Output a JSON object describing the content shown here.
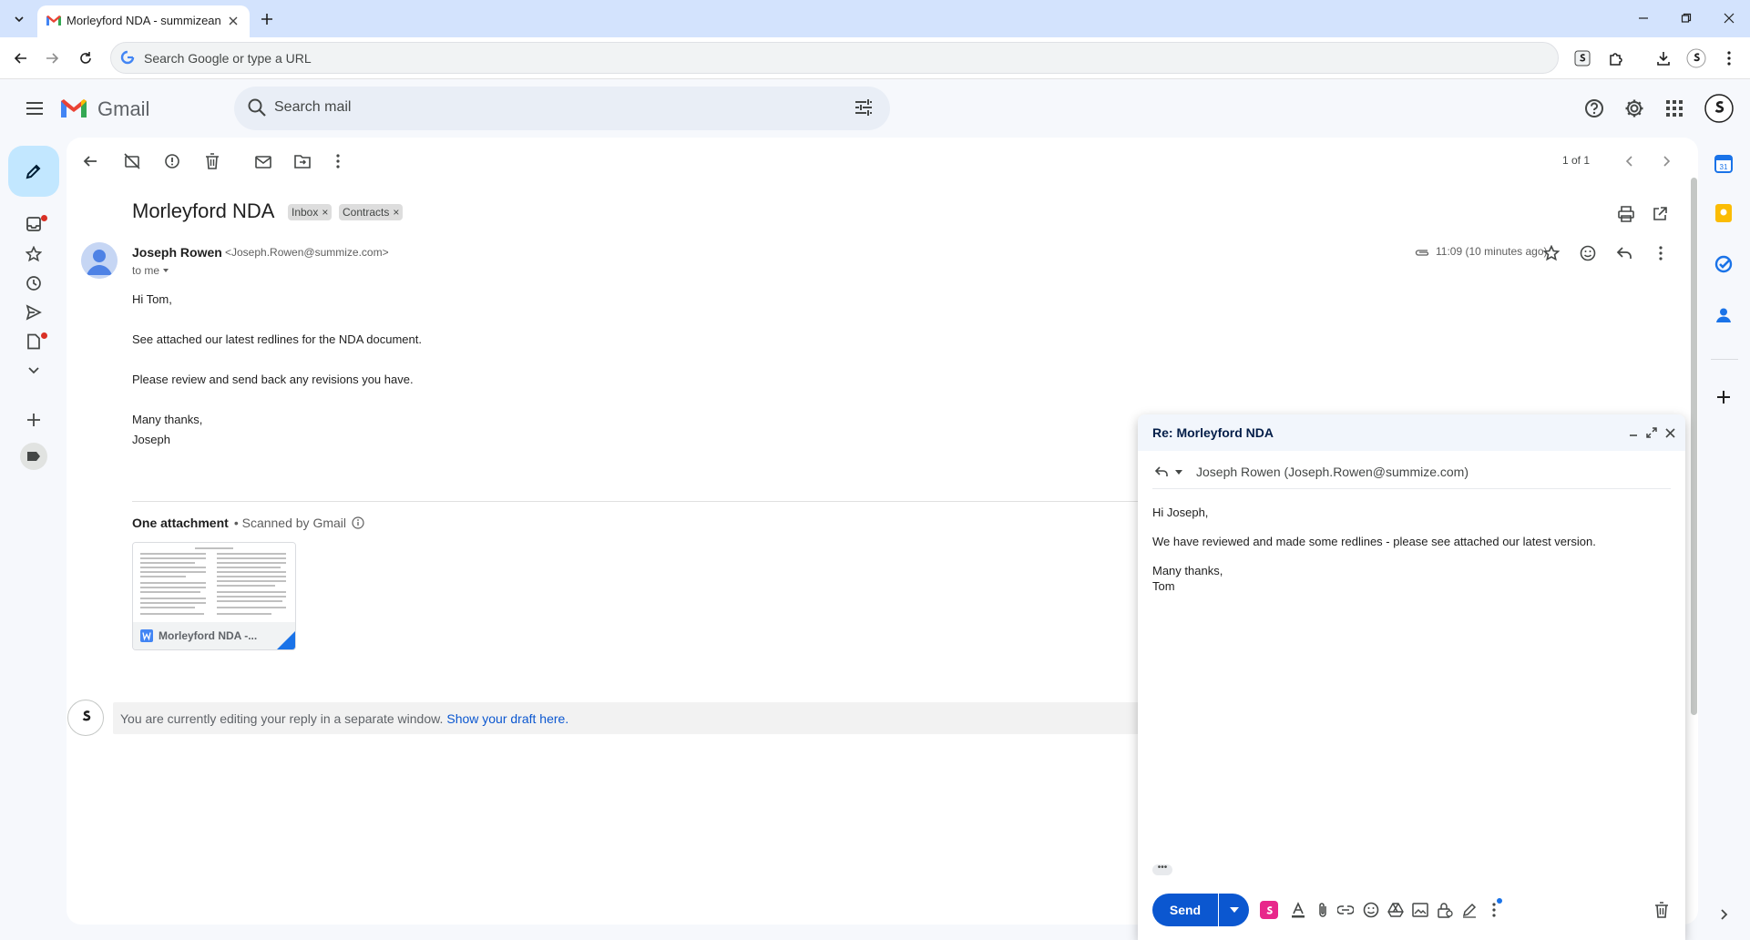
{
  "browser": {
    "tab_title": "Morleyford NDA - summizeana",
    "omnibox_placeholder": "Search Google or type a URL"
  },
  "gmail": {
    "brand": "Gmail",
    "search_placeholder": "Search mail"
  },
  "toolbar": {
    "pager": "1 of 1"
  },
  "message": {
    "subject": "Morleyford NDA",
    "labels": [
      "Inbox",
      "Contracts"
    ],
    "sender_name": "Joseph Rowen",
    "sender_email": "<Joseph.Rowen@summize.com>",
    "to_me": "to me",
    "time": "11:09 (10 minutes ago)",
    "body": [
      "Hi Tom,",
      "See attached our latest redlines for the NDA document.",
      "Please review and send back any revisions you have.",
      "Many thanks,",
      "Joseph"
    ],
    "attachment_heading": "One attachment",
    "attachment_scanned": "• Scanned by Gmail",
    "attachment_name": "Morleyford NDA -..."
  },
  "draft_notice": {
    "text": "You are currently editing your reply in a separate window.",
    "link": "Show your draft here."
  },
  "compose": {
    "title": "Re: Morleyford NDA",
    "recipient": "Joseph Rowen (Joseph.Rowen@summize.com)",
    "body": [
      "Hi Joseph,",
      "We have reviewed and made some redlines - please see attached our latest version.",
      "Many thanks,",
      "Tom"
    ],
    "send_label": "Send"
  },
  "colors": {
    "accent": "#0b57d0",
    "compose_fill": "#c2e7ff",
    "tabstrip": "#d3e3fd",
    "link": "#0b57d0",
    "summize_pink": "#e8278b"
  }
}
